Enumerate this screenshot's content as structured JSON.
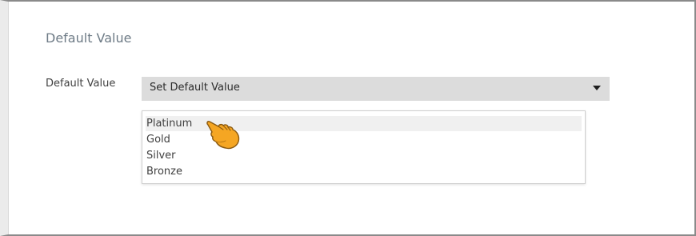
{
  "section": {
    "title": "Default Value"
  },
  "field": {
    "label": "Default Value",
    "select_value": "Set Default Value",
    "options": [
      {
        "label": "Platinum",
        "hovered": true
      },
      {
        "label": "Gold"
      },
      {
        "label": "Silver"
      },
      {
        "label": "Bronze"
      }
    ]
  },
  "icons": {
    "dropdown": "caret-down-icon",
    "pointer": "hand-pointer-cursor-icon"
  },
  "colors": {
    "select_bg": "#dcdcdc",
    "hover_bg": "#f0f0f0",
    "cursor_fill": "#f5a623",
    "title_color": "#6e7b86"
  }
}
